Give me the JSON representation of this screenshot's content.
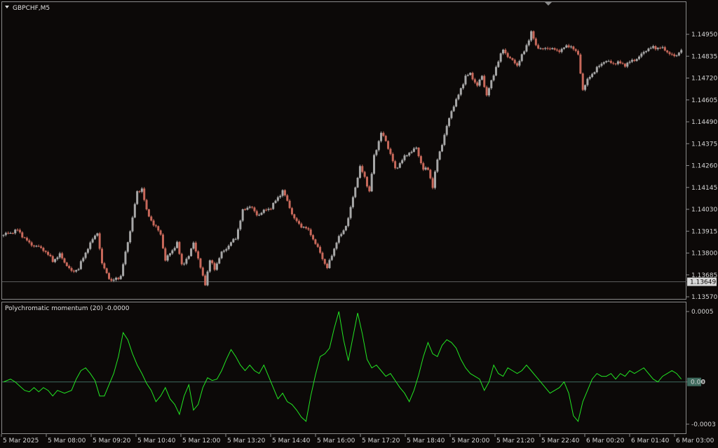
{
  "header": {
    "symbol": "GBPCHF,M5",
    "indicator_title": "Polychromatic momentum (20) -0.0000"
  },
  "colors": {
    "background": "#0c0908",
    "bull_candle": "#a7a7a7",
    "bear_candle": "#c8685a",
    "indicator_line": "#22e622",
    "frame": "#8a8a8a",
    "zero_line": "#3f6b5e",
    "text": "#d6d6d6"
  },
  "chart_data": [
    {
      "type": "candlestick",
      "title": "GBPCHF,M5",
      "y_tick_labels": [
        "1.14950",
        "1.14835",
        "1.14720",
        "1.14605",
        "1.14490",
        "1.14375",
        "1.14260",
        "1.14145",
        "1.14030",
        "1.13915",
        "1.13800",
        "1.13685",
        "1.13570"
      ],
      "ylim": [
        1.1357,
        1.1502
      ],
      "current_price_label": "1.13649",
      "x_tick_labels": [
        "5 Mar 2025",
        "5 Mar 08:00",
        "5 Mar 09:20",
        "5 Mar 10:40",
        "5 Mar 12:00",
        "5 Mar 13:20",
        "5 Mar 14:40",
        "5 Mar 16:00",
        "5 Mar 17:20",
        "5 Mar 18:40",
        "5 Mar 20:00",
        "5 Mar 21:20",
        "5 Mar 22:40",
        "6 Mar 00:20",
        "6 Mar 01:40",
        "6 Mar 03:00"
      ],
      "close_path": [
        [
          0,
          1.13895
        ],
        [
          6,
          1.1392
        ],
        [
          11,
          1.1385
        ],
        [
          17,
          1.1382
        ],
        [
          21,
          1.1376
        ],
        [
          24,
          1.1379
        ],
        [
          29,
          1.137
        ],
        [
          32,
          1.1372
        ],
        [
          36,
          1.1383
        ],
        [
          40,
          1.1391
        ],
        [
          42,
          1.1374
        ],
        [
          46,
          1.1365
        ],
        [
          50,
          1.1368
        ],
        [
          54,
          1.1392
        ],
        [
          57,
          1.1412
        ],
        [
          59,
          1.1414
        ],
        [
          61,
          1.1402
        ],
        [
          64,
          1.1395
        ],
        [
          67,
          1.139
        ],
        [
          69,
          1.1376
        ],
        [
          71,
          1.138
        ],
        [
          74,
          1.1385
        ],
        [
          76,
          1.1374
        ],
        [
          79,
          1.1378
        ],
        [
          81,
          1.1386
        ],
        [
          84,
          1.1372
        ],
        [
          86,
          1.1364
        ],
        [
          88,
          1.1376
        ],
        [
          90,
          1.1372
        ],
        [
          93,
          1.138
        ],
        [
          96,
          1.1384
        ],
        [
          99,
          1.1388
        ],
        [
          102,
          1.1402
        ],
        [
          105,
          1.1405
        ],
        [
          108,
          1.14
        ],
        [
          111,
          1.1402
        ],
        [
          114,
          1.1404
        ],
        [
          117,
          1.1409
        ],
        [
          119,
          1.1413
        ],
        [
          122,
          1.1404
        ],
        [
          124,
          1.1398
        ],
        [
          126,
          1.1395
        ],
        [
          129,
          1.1393
        ],
        [
          131,
          1.139
        ],
        [
          133,
          1.1385
        ],
        [
          135,
          1.138
        ],
        [
          138,
          1.1372
        ],
        [
          140,
          1.1379
        ],
        [
          142,
          1.1386
        ],
        [
          145,
          1.1392
        ],
        [
          147,
          1.1398
        ],
        [
          150,
          1.1415
        ],
        [
          152,
          1.1425
        ],
        [
          154,
          1.142
        ],
        [
          156,
          1.1412
        ],
        [
          158,
          1.1431
        ],
        [
          161,
          1.1443
        ],
        [
          163,
          1.1439
        ],
        [
          165,
          1.1432
        ],
        [
          167,
          1.1424
        ],
        [
          170,
          1.1429
        ],
        [
          173,
          1.1433
        ],
        [
          176,
          1.1435
        ],
        [
          179,
          1.1424
        ],
        [
          181,
          1.1424
        ],
        [
          183,
          1.1415
        ],
        [
          185,
          1.1429
        ],
        [
          188,
          1.1442
        ],
        [
          191,
          1.1455
        ],
        [
          194,
          1.1463
        ],
        [
          197,
          1.1473
        ],
        [
          199,
          1.1474
        ],
        [
          202,
          1.1468
        ],
        [
          204,
          1.1473
        ],
        [
          206,
          1.1463
        ],
        [
          208,
          1.147
        ],
        [
          210,
          1.1478
        ],
        [
          213,
          1.1487
        ],
        [
          216,
          1.1482
        ],
        [
          219,
          1.1479
        ],
        [
          222,
          1.1486
        ],
        [
          225,
          1.1496
        ],
        [
          227,
          1.1489
        ],
        [
          230,
          1.1487
        ],
        [
          233,
          1.1488
        ],
        [
          236,
          1.1486
        ],
        [
          239,
          1.1488
        ],
        [
          242,
          1.1489
        ],
        [
          245,
          1.1484
        ],
        [
          247,
          1.1466
        ],
        [
          250,
          1.1473
        ],
        [
          253,
          1.1477
        ],
        [
          256,
          1.1481
        ],
        [
          259,
          1.148
        ],
        [
          262,
          1.148
        ],
        [
          265,
          1.1479
        ],
        [
          268,
          1.1481
        ],
        [
          271,
          1.1483
        ],
        [
          274,
          1.1487
        ],
        [
          277,
          1.1488
        ],
        [
          280,
          1.1488
        ],
        [
          283,
          1.1486
        ],
        [
          286,
          1.1483
        ],
        [
          289,
          1.1487
        ]
      ]
    },
    {
      "type": "line",
      "title": "Polychromatic momentum (20) -0.0000",
      "y_tick_labels": [
        "0.0005",
        "0.00",
        "-0.0003"
      ],
      "ylim": [
        -0.00033,
        0.00054
      ],
      "current_value_label": "0.00",
      "series": [
        {
          "values": [
            [
              0,
              0.0
            ],
            [
              3,
              2e-05
            ],
            [
              5,
              0.0
            ],
            [
              7,
              -3e-05
            ],
            [
              9,
              -6e-05
            ],
            [
              11,
              -7e-05
            ],
            [
              13,
              -4e-05
            ],
            [
              15,
              -7e-05
            ],
            [
              17,
              -4e-05
            ],
            [
              19,
              -6e-05
            ],
            [
              21,
              -0.0001
            ],
            [
              23,
              -6e-05
            ],
            [
              26,
              -8e-05
            ],
            [
              29,
              -6e-05
            ],
            [
              31,
              2e-05
            ],
            [
              33,
              8e-05
            ],
            [
              35,
              0.0001
            ],
            [
              37,
              6e-05
            ],
            [
              39,
              1e-05
            ],
            [
              41,
              -0.0001
            ],
            [
              43,
              -0.0001
            ],
            [
              45,
              -2e-05
            ],
            [
              47,
              6e-05
            ],
            [
              49,
              0.00018
            ],
            [
              51,
              0.00035
            ],
            [
              53,
              0.0003
            ],
            [
              55,
              0.0002
            ],
            [
              57,
              0.00012
            ],
            [
              59,
              6e-05
            ],
            [
              61,
              -1e-05
            ],
            [
              63,
              -6e-05
            ],
            [
              65,
              -0.00014
            ],
            [
              67,
              -0.0001
            ],
            [
              69,
              -4e-05
            ],
            [
              71,
              -0.00012
            ],
            [
              73,
              -0.00016
            ],
            [
              75,
              -0.00023
            ],
            [
              77,
              -0.0001
            ],
            [
              79,
              -2e-05
            ],
            [
              81,
              -0.0002
            ],
            [
              83,
              -0.00016
            ],
            [
              85,
              -4e-05
            ],
            [
              87,
              3e-05
            ],
            [
              89,
              1e-05
            ],
            [
              91,
              2e-05
            ],
            [
              93,
              8e-05
            ],
            [
              95,
              0.00016
            ],
            [
              97,
              0.00023
            ],
            [
              99,
              0.00018
            ],
            [
              101,
              0.00012
            ],
            [
              103,
              8e-05
            ],
            [
              105,
              0.00012
            ],
            [
              107,
              8e-05
            ],
            [
              109,
              6e-05
            ],
            [
              111,
              0.00012
            ],
            [
              113,
              4e-05
            ],
            [
              115,
              -4e-05
            ],
            [
              117,
              -0.00012
            ],
            [
              119,
              -8e-05
            ],
            [
              121,
              -0.00014
            ],
            [
              123,
              -0.00016
            ],
            [
              125,
              -0.0002
            ],
            [
              127,
              -0.00025
            ],
            [
              129,
              -0.00028
            ],
            [
              131,
              -0.0001
            ],
            [
              133,
              5e-05
            ],
            [
              135,
              0.00018
            ],
            [
              137,
              0.0002
            ],
            [
              139,
              0.00024
            ],
            [
              141,
              0.00038
            ],
            [
              143,
              0.0005
            ],
            [
              145,
              0.0003
            ],
            [
              147,
              0.00015
            ],
            [
              149,
              0.00032
            ],
            [
              151,
              0.00049
            ],
            [
              153,
              0.00034
            ],
            [
              155,
              0.00016
            ],
            [
              157,
              0.0001
            ],
            [
              159,
              0.00012
            ],
            [
              161,
              8e-05
            ],
            [
              163,
              4e-05
            ],
            [
              165,
              6e-05
            ],
            [
              167,
              1e-05
            ],
            [
              169,
              -4e-05
            ],
            [
              171,
              -8e-05
            ],
            [
              173,
              -0.00014
            ],
            [
              175,
              -6e-05
            ],
            [
              177,
              5e-05
            ],
            [
              179,
              0.00018
            ],
            [
              181,
              0.00028
            ],
            [
              183,
              0.0002
            ],
            [
              185,
              0.00018
            ],
            [
              187,
              0.00026
            ],
            [
              189,
              0.0003
            ],
            [
              191,
              0.00028
            ],
            [
              193,
              0.00024
            ],
            [
              195,
              0.00016
            ],
            [
              197,
              0.0001
            ],
            [
              199,
              6e-05
            ],
            [
              201,
              4e-05
            ],
            [
              203,
              2e-05
            ],
            [
              205,
              -6e-05
            ],
            [
              207,
              0.0
            ],
            [
              209,
              0.00012
            ],
            [
              211,
              6e-05
            ],
            [
              213,
              4e-05
            ],
            [
              215,
              0.0001
            ],
            [
              217,
              8e-05
            ],
            [
              219,
              6e-05
            ],
            [
              221,
              8e-05
            ],
            [
              223,
              0.00012
            ],
            [
              225,
              8e-05
            ],
            [
              227,
              4e-05
            ],
            [
              229,
              0.0
            ],
            [
              231,
              -4e-05
            ],
            [
              233,
              -8e-05
            ],
            [
              235,
              -6e-05
            ],
            [
              237,
              -4e-05
            ],
            [
              239,
              0.0
            ],
            [
              241,
              -8e-05
            ],
            [
              243,
              -0.00024
            ],
            [
              245,
              -0.00028
            ],
            [
              247,
              -0.00014
            ],
            [
              249,
              -6e-05
            ],
            [
              251,
              2e-05
            ],
            [
              253,
              6e-05
            ],
            [
              255,
              4e-05
            ],
            [
              257,
              4e-05
            ],
            [
              259,
              6e-05
            ],
            [
              261,
              2e-05
            ],
            [
              263,
              6e-05
            ],
            [
              265,
              4e-05
            ],
            [
              267,
              8e-05
            ],
            [
              269,
              6e-05
            ],
            [
              271,
              8e-05
            ],
            [
              273,
              0.0001
            ],
            [
              275,
              6e-05
            ],
            [
              277,
              2e-05
            ],
            [
              279,
              0.0
            ],
            [
              281,
              4e-05
            ],
            [
              283,
              6e-05
            ],
            [
              285,
              8e-05
            ],
            [
              287,
              6e-05
            ],
            [
              289,
              2e-05
            ]
          ]
        }
      ]
    }
  ]
}
